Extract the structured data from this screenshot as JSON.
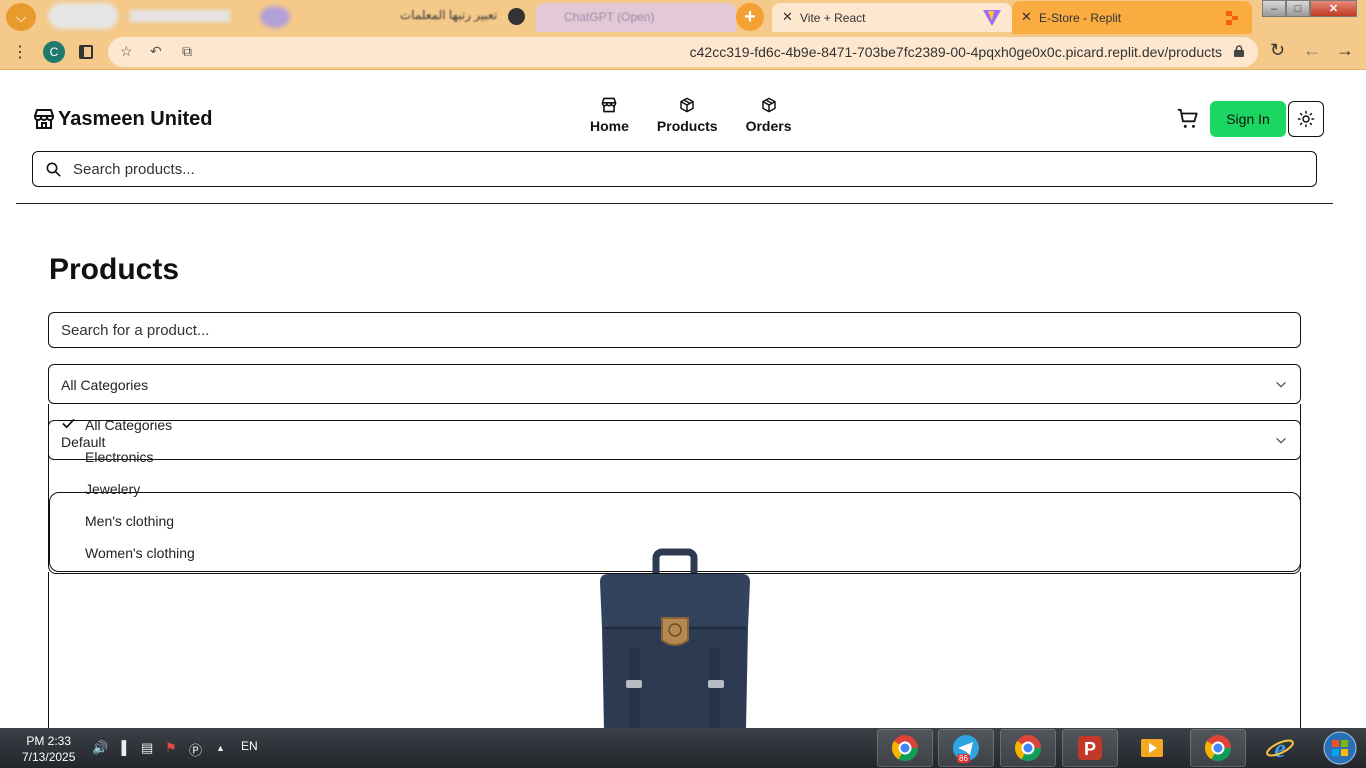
{
  "browser": {
    "blurred_tab_rtl": "تعبير رتبها المعلمات",
    "tab_chatgpt_title": "ChatGPT (Open)",
    "tab_vite_title": "Vite + React",
    "tab_replit_title": "E-Store - Replit",
    "profile_initial": "C",
    "url": "c42cc319-fd6c-4b9e-8471-703be7fc2389-00-4pqxh0ge0x0c.picard.replit.dev/products"
  },
  "header": {
    "brand": "Yasmeen United",
    "nav": [
      {
        "label": "Home"
      },
      {
        "label": "Products"
      },
      {
        "label": "Orders"
      }
    ],
    "signin_label": "Sign In",
    "search_placeholder": "Search products..."
  },
  "main": {
    "title": "Products",
    "product_search_placeholder": "Search for a product...",
    "category_selected": "All Categories",
    "sort_selected": "Default",
    "category_options": [
      {
        "label": "All Categories",
        "checked": true
      },
      {
        "label": "Electronics"
      },
      {
        "label": "Jewelery"
      },
      {
        "label": "Men's clothing"
      },
      {
        "label": "Women's clothing"
      }
    ]
  },
  "taskbar": {
    "time": "PM 2:33",
    "date": "7/13/2025",
    "language": "EN",
    "telegram_badge": "86"
  },
  "colors": {
    "browser_frame": "#f4c98a",
    "active_tab": "#fbac41",
    "signin_button": "#1bd761",
    "taskbar": "#2b2f35"
  }
}
